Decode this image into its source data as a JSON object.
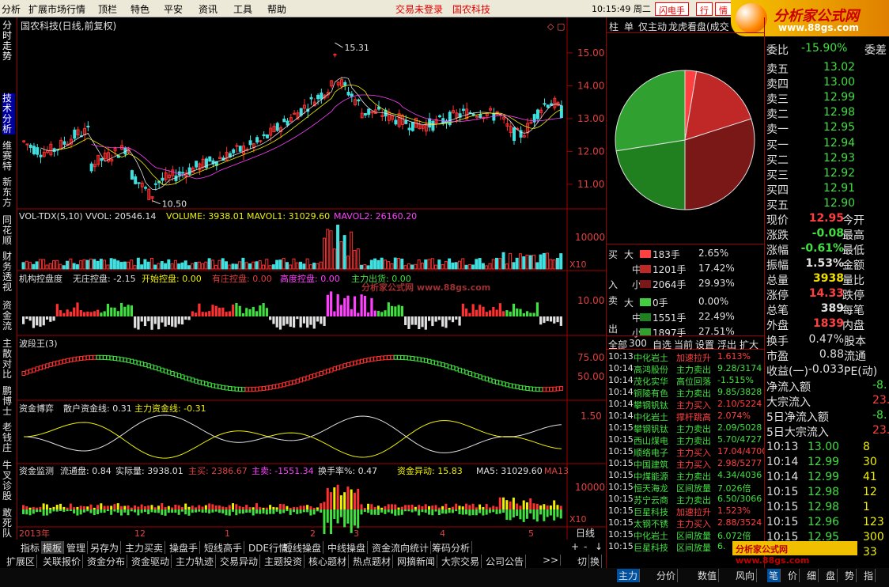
{
  "menu": {
    "items": [
      "分析",
      "扩展市场行情",
      "顶栏",
      "特色",
      "平安",
      "资讯",
      "工具",
      "帮助"
    ],
    "status1": "交易未登录",
    "status2": "国农科技",
    "clock": "10:15:49 周二",
    "btn1": "闪电手",
    "btn2": "行",
    "btn3": "情"
  },
  "logo": {
    "name": "分析家公式网",
    "url": "www.88gs.com"
  },
  "left_tabs": [
    "分时走势",
    "技术分析",
    "维赛特",
    "新东方",
    "同花顺",
    "财务透视",
    "资金流",
    "主散对比",
    "鹏博士",
    "老钱庄",
    "牛叉诊股",
    "敢死队"
  ],
  "chart": {
    "title": "国农科技(日线,前复权)",
    "price_high": "15.31",
    "price_low": "10.50",
    "price_ticks": [
      "15.00",
      "14.00",
      "13.00",
      "12.00",
      "11.00"
    ],
    "vol_header": {
      "name": "VOL-TDX(5,10)",
      "vvol": "VVOL: 20546.14",
      "volume": "VOLUME: 3938.01",
      "mavol1": "MAVOL1: 31029.60",
      "mavol2": "MAVOL2: 26160.20"
    },
    "vol_tick": "10000",
    "x10": "X10",
    "jg_header": {
      "name": "机构控盘度",
      "wz": "无庄控盘: -2.15",
      "kc": "开始控盘: 0.00",
      "yz": "有庄控盘: 0.00",
      "gd": "高度控盘: 0.00",
      "zl": "主力出货: 0.00"
    },
    "jg_tick": "10.00",
    "bd_header": "波段王(3)",
    "bd_ticks": [
      "75.00",
      "50.00"
    ],
    "zj_header": {
      "name": "资金博弈",
      "sh": "散户资金线: 0.31",
      "zl": "主力资金线: -0.31"
    },
    "zj_tick": "1.50",
    "zjjc_header": {
      "name": "资金监测",
      "ltp": "流通盘: 0.84",
      "sjl": "实际量: 3938.01",
      "zm": "主买: 2386.67",
      "zmai": "主卖: -1551.34",
      "hsl": "换手率%: 0.47",
      "zjyd": "资金异动: 15.83",
      "ma5": "MA5: 31029.60",
      "ma1": "MA13"
    },
    "zjjc_tick": "10000",
    "x_labels": [
      "2013年",
      "12",
      "1",
      "2",
      "3",
      "4",
      "5"
    ],
    "period": "日线",
    "watermark": "分析家公式网 www.88gs.com"
  },
  "chart_data": {
    "type": "candlestick",
    "title": "国农科技(日线,前复权)",
    "y_range": [
      10.5,
      15.31
    ],
    "ylim": [
      10.3,
      15.6
    ],
    "annotations": [
      {
        "label": "15.31",
        "value": 15.31
      },
      {
        "label": "10.50",
        "value": 10.5
      }
    ],
    "x_labels": [
      "2013年",
      "12",
      "1",
      "2",
      "3",
      "4",
      "5"
    ]
  },
  "pie": {
    "slices": [
      {
        "name": "183手",
        "pct": 2.65,
        "color": "#ff4040"
      },
      {
        "name": "1201手",
        "pct": 17.42,
        "color": "#c02828"
      },
      {
        "name": "2064手",
        "pct": 29.93,
        "color": "#7a1818"
      },
      {
        "name": "0手",
        "pct": 0.0,
        "color": "#40d040"
      },
      {
        "name": "1551手",
        "pct": 22.49,
        "color": "#208020"
      },
      {
        "name": "1897手",
        "pct": 27.51,
        "color": "#30a030"
      }
    ]
  },
  "right_tabs": [
    "柱",
    "单",
    "仅主动",
    "龙虎看盘(成交"
  ],
  "flow": {
    "buy_label": "买",
    "in_label": "入",
    "sell_label": "卖",
    "out_label": "出",
    "rows": [
      {
        "size": "大",
        "vol": "183手",
        "pct": "2.65%",
        "color": "#ff4040"
      },
      {
        "size": "中",
        "vol": "1201手",
        "pct": "17.42%",
        "color": "#c02828"
      },
      {
        "size": "小",
        "vol": "2064手",
        "pct": "29.93%",
        "color": "#7a1818"
      },
      {
        "size": "大",
        "vol": "0手",
        "pct": "0.00%",
        "color": "#40d040"
      },
      {
        "size": "中",
        "vol": "1551手",
        "pct": "22.49%",
        "color": "#208020"
      },
      {
        "size": "小",
        "vol": "1897手",
        "pct": "27.51%",
        "color": "#30a030"
      }
    ]
  },
  "stream_tabs": [
    "全部",
    "300",
    "自选",
    "当前",
    "设置",
    "浮出",
    "扩大"
  ],
  "stream": [
    {
      "t": "10:13",
      "n": "中化岩土",
      "a": "加速拉升",
      "v": "1.613%",
      "c": "#ff4040"
    },
    {
      "t": "10:14",
      "n": "高鸿股份",
      "a": "主力卖出",
      "v": "9.28/3174",
      "c": "#40e040"
    },
    {
      "t": "10:14",
      "n": "茂化实华",
      "a": "高位回落",
      "v": "-1.515%",
      "c": "#40e040"
    },
    {
      "t": "10:14",
      "n": "铜陵有色",
      "a": "主力卖出",
      "v": "9.85/3828",
      "c": "#40e040"
    },
    {
      "t": "10:14",
      "n": "攀钢钒钛",
      "a": "主力买入",
      "v": "2.10/5224",
      "c": "#ff4040"
    },
    {
      "t": "10:14",
      "n": "中化岩土",
      "a": "撑杆跳高",
      "v": "2.074%",
      "c": "#ff4040"
    },
    {
      "t": "10:15",
      "n": "攀钢钒钛",
      "a": "主力卖出",
      "v": "2.09/5028",
      "c": "#40e040"
    },
    {
      "t": "10:15",
      "n": "西山煤电",
      "a": "主力卖出",
      "v": "5.70/4727",
      "c": "#40e040"
    },
    {
      "t": "10:15",
      "n": "顺络电子",
      "a": "主力买入",
      "v": "17.04/4700",
      "c": "#ff4040"
    },
    {
      "t": "10:15",
      "n": "中国建筑",
      "a": "主力买入",
      "v": "2.98/5277",
      "c": "#ff4040"
    },
    {
      "t": "10:15",
      "n": "中煤能源",
      "a": "主力卖出",
      "v": "4.34/4036",
      "c": "#40e040"
    },
    {
      "t": "10:15",
      "n": "恒天海龙",
      "a": "区间放量",
      "v": "7.026倍",
      "c": "#40e040"
    },
    {
      "t": "10:15",
      "n": "苏宁云商",
      "a": "主力卖出",
      "v": "6.50/3066",
      "c": "#40e040"
    },
    {
      "t": "10:15",
      "n": "巨星科技",
      "a": "加速拉升",
      "v": "1.523%",
      "c": "#ff4040"
    },
    {
      "t": "10:15",
      "n": "太钢不锈",
      "a": "主力买入",
      "v": "2.88/3524",
      "c": "#ff4040"
    },
    {
      "t": "10:15",
      "n": "中化岩土",
      "a": "区间放量",
      "v": "6.072倍",
      "c": "#40e040"
    },
    {
      "t": "10:15",
      "n": "巨星科技",
      "a": "区间放量",
      "v": "6.",
      "c": "#40e040"
    }
  ],
  "quote": {
    "wb_label": "委比",
    "wb": "-15.90%",
    "wc_label": "委差",
    "sell": [
      {
        "l": "卖五",
        "p": "13.02"
      },
      {
        "l": "卖四",
        "p": "13.00"
      },
      {
        "l": "卖三",
        "p": "12.99"
      },
      {
        "l": "卖二",
        "p": "12.98"
      },
      {
        "l": "卖一",
        "p": "12.95"
      }
    ],
    "buy": [
      {
        "l": "买一",
        "p": "12.94"
      },
      {
        "l": "买二",
        "p": "12.93"
      },
      {
        "l": "买三",
        "p": "12.92"
      },
      {
        "l": "买四",
        "p": "12.91"
      },
      {
        "l": "买五",
        "p": "12.90"
      }
    ],
    "stats": [
      {
        "l": "现价",
        "v": "12.95",
        "c": "#ff4040",
        "r": "今开"
      },
      {
        "l": "涨跌",
        "v": "-0.08",
        "c": "#40e040",
        "r": "最高"
      },
      {
        "l": "涨幅",
        "v": "-0.61%",
        "c": "#40e040",
        "r": "最低"
      },
      {
        "l": "振幅",
        "v": "1.53%",
        "c": "#e0e0e0",
        "r": "金额"
      },
      {
        "l": "总量",
        "v": "3938",
        "c": "#f0e000",
        "r": "量比"
      },
      {
        "l": "涨停",
        "v": "14.33",
        "c": "#ff4040",
        "r": "跌停"
      },
      {
        "l": "总笔",
        "v": "389",
        "c": "#e0e0e0",
        "r": "每笔"
      },
      {
        "l": "外盘",
        "v": "1839",
        "c": "#ff4040",
        "r": "内盘"
      }
    ],
    "hs": [
      {
        "l": "换手",
        "v": "0.47%",
        "r": "股本"
      },
      {
        "l": "市盈",
        "v": "0.88",
        "r": "流通"
      },
      {
        "l": "收益(一)",
        "v": "-0.033",
        "r": "PE(动)"
      }
    ],
    "netflow": [
      {
        "l": "净流入额",
        "v": "-8."
      },
      {
        "l": "大宗流入",
        "v": "23."
      },
      {
        "l": "5日净流入额",
        "v": "-8."
      },
      {
        "l": "5日大宗流入",
        "v": "23."
      }
    ],
    "ticks": [
      {
        "t": "10:13",
        "p": "13.00",
        "v": "8"
      },
      {
        "t": "10:14",
        "p": "12.99",
        "v": "30"
      },
      {
        "t": "10:14",
        "p": "12.99",
        "v": "41"
      },
      {
        "t": "10:15",
        "p": "12.98",
        "v": "12"
      },
      {
        "t": "10:15",
        "p": "12.98",
        "v": "1"
      },
      {
        "t": "10:15",
        "p": "12.96",
        "v": "123"
      },
      {
        "t": "10:15",
        "p": "12.95",
        "v": "300"
      },
      {
        "t": "10:15",
        "p": "",
        "v": "33"
      }
    ]
  },
  "bottom1": [
    "指标",
    "模板",
    "管理",
    "另存为",
    "主力买卖",
    "操盘手",
    "短线高手",
    "DDE行情",
    "短线操盘",
    "中线操盘",
    "资金流向统计",
    "筹码分析"
  ],
  "bottom2": [
    "扩展区",
    "关联报价",
    "资金分布",
    "资金驱动",
    "主力轨迹",
    "交易异动",
    "主题投资",
    "核心题材",
    "热点题材",
    "网摘新闻",
    "大宗交易",
    "公司公告"
  ],
  "bottom2_right": [
    "切",
    "换"
  ],
  "bottom3": [
    "主力",
    "分价",
    "数值",
    "风向"
  ],
  "bottom3_right": [
    "笔",
    "价",
    "细",
    "盘",
    "势",
    "指"
  ],
  "period_ctrl": [
    "+",
    "-",
    "↓"
  ]
}
